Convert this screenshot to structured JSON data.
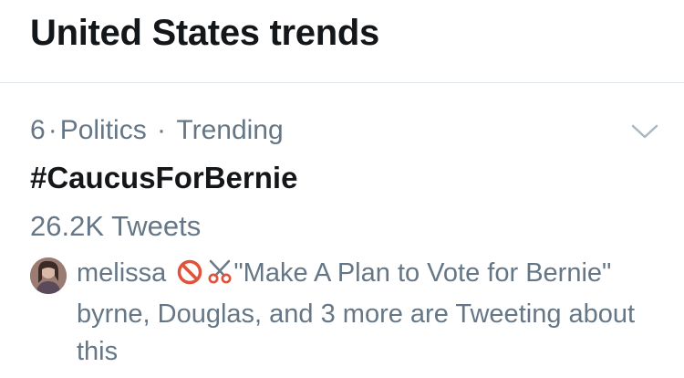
{
  "header": {
    "title": "United States trends"
  },
  "trend": {
    "rank": "6",
    "category": "Politics",
    "status": "Trending",
    "name": "#CaucusForBernie",
    "tweet_count": "26.2K Tweets",
    "context": {
      "user": "melissa",
      "emojis": [
        "no-entry-sign-emoji",
        "scissors-emoji"
      ],
      "quote": "\"Make A Plan to Vote for Bernie\"",
      "summary": "byrne, Douglas, and 3 more are Tweeting about this"
    }
  },
  "colors": {
    "text_primary": "#14171a",
    "text_secondary": "#657786",
    "divider": "#e1e8ed",
    "chevron": "#aab8c2",
    "no_entry_red": "#e0533b"
  }
}
